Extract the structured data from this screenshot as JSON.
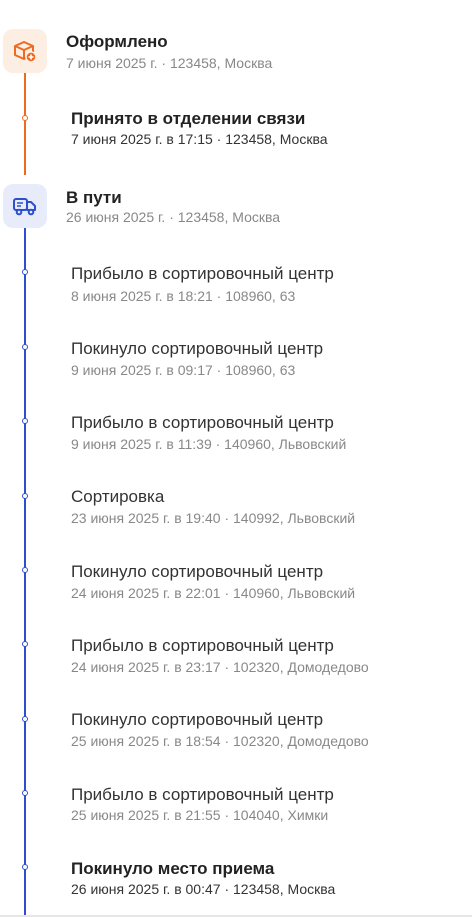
{
  "stages": {
    "done": {
      "title": "Оформлено",
      "subtitle": "7 июня 2025 г. · 123458, Москва",
      "icon": "box-add-icon",
      "color": "#ee6a1f"
    },
    "transit": {
      "title": "В пути",
      "subtitle": "26 июня 2025 г. · 123458, Москва",
      "icon": "truck-icon",
      "color": "#2d4fcf"
    }
  },
  "events": [
    {
      "title": "Принято в отделении связи",
      "detail": "7 июня 2025 г. в 17:15 · 123458, Москва",
      "highlight": true
    },
    {
      "title": "Прибыло в сортировочный центр",
      "detail": "8 июня 2025 г. в 18:21 · 108960, 63",
      "highlight": false
    },
    {
      "title": "Покинуло сортировочный центр",
      "detail": "9 июня 2025 г. в 09:17 · 108960, 63",
      "highlight": false
    },
    {
      "title": "Прибыло в сортировочный центр",
      "detail": "9 июня 2025 г. в 11:39 · 140960, Львовский",
      "highlight": false
    },
    {
      "title": "Сортировка",
      "detail": "23 июня 2025 г. в 19:40 · 140992, Львовский",
      "highlight": false
    },
    {
      "title": "Покинуло сортировочный центр",
      "detail": "24 июня 2025 г. в 22:01 · 140960, Львовский",
      "highlight": false
    },
    {
      "title": "Прибыло в сортировочный центр",
      "detail": "24 июня 2025 г. в 23:17 · 102320, Домодедово",
      "highlight": false
    },
    {
      "title": "Покинуло сортировочный центр",
      "detail": "25 июня 2025 г. в 18:54 · 102320, Домодедово",
      "highlight": false
    },
    {
      "title": "Прибыло в сортировочный центр",
      "detail": "25 июня 2025 г. в 21:55 · 104040, Химки",
      "highlight": false
    },
    {
      "title": "Покинуло место приема",
      "detail": "26 июня 2025 г. в 00:47 · 123458, Москва",
      "highlight": true
    }
  ]
}
